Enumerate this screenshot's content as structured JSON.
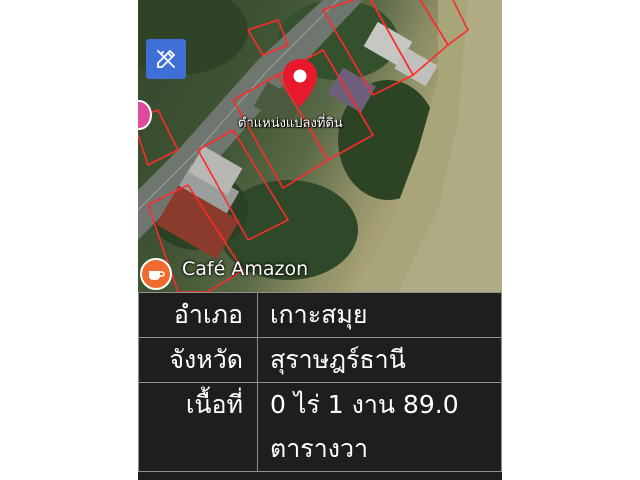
{
  "map": {
    "pin_label": "ตำแหน่งแปลงที่ดิน",
    "poi_label": "Café Amazon",
    "tool_icon": "pencil-ruler-icon",
    "pin_icon": "map-pin-icon",
    "poi_icon": "coffee-cup-icon",
    "colors": {
      "tool_button": "#3f6fd6",
      "pin": "#e8192c",
      "parcel_outline": "#ff2a2a",
      "poi": "#ef6c2e"
    }
  },
  "info": {
    "rows": [
      {
        "label": "อำเภอ",
        "value": "เกาะสมุย"
      },
      {
        "label": "จังหวัด",
        "value": "สุราษฎร์ธานี"
      },
      {
        "label": "เนื้อที่",
        "value": "0 ไร่ 1 งาน 89.0 ตารางวา"
      }
    ]
  }
}
